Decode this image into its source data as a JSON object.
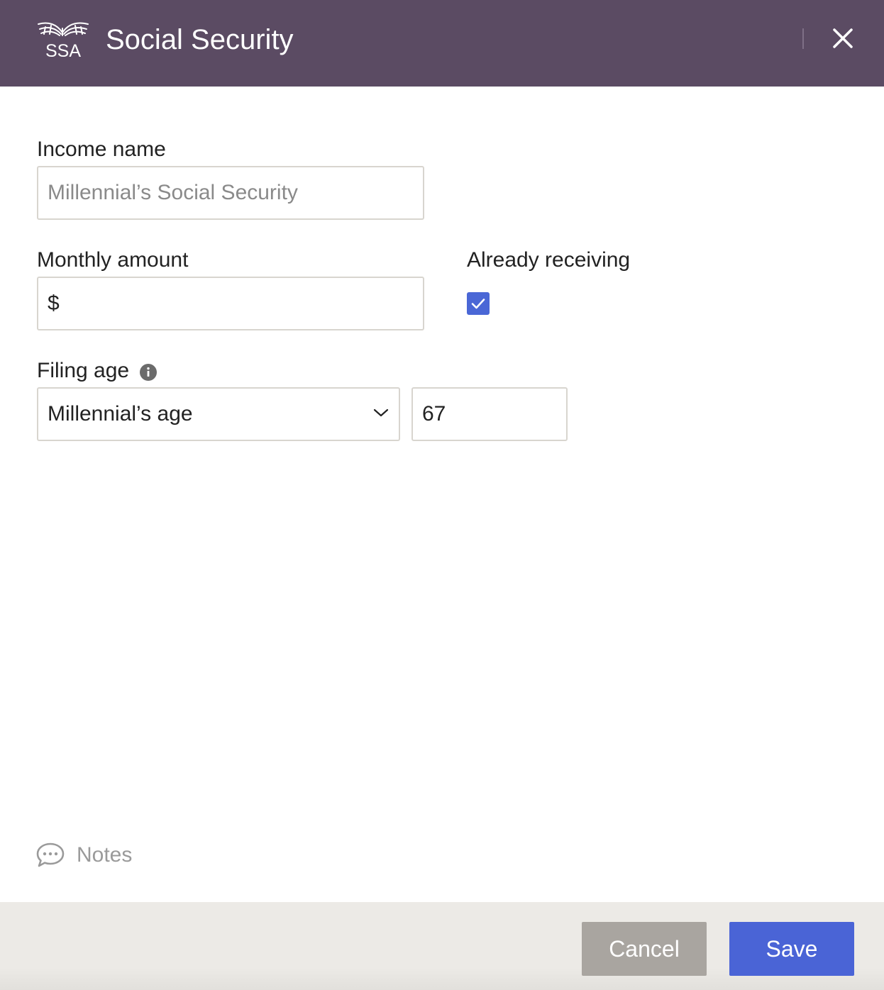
{
  "header": {
    "title": "Social Security",
    "logo_text": "SSA",
    "logo_icon": "eagle-icon",
    "close_icon": "close-icon",
    "background_color": "#5b4b63"
  },
  "form": {
    "income_name": {
      "label": "Income name",
      "value": "",
      "placeholder": "Millennial’s Social Security"
    },
    "monthly_amount": {
      "label": "Monthly amount",
      "prefix": "$",
      "value": ""
    },
    "already_receiving": {
      "label": "Already receiving",
      "checked": true
    },
    "filing_age": {
      "label": "Filing age",
      "info_icon": "info-icon",
      "selected_option": "Millennial’s age",
      "age_value": "67"
    }
  },
  "notes": {
    "label": "Notes",
    "icon": "speech-bubble-icon"
  },
  "footer": {
    "cancel_label": "Cancel",
    "save_label": "Save",
    "save_color": "#4a64d6",
    "cancel_color": "#a9a5a0"
  }
}
